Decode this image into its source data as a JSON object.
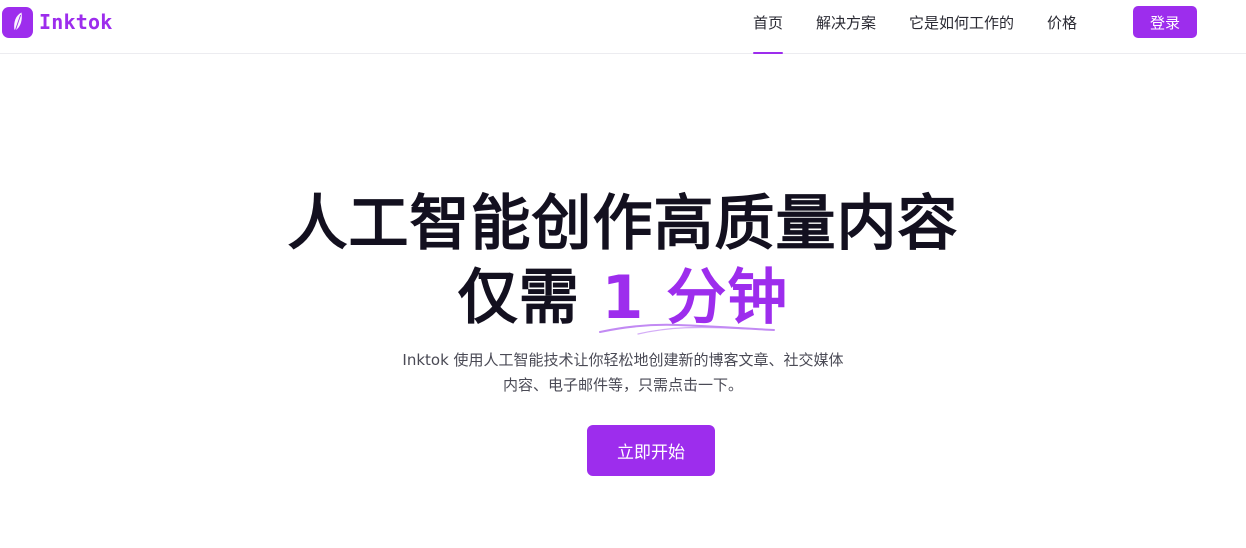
{
  "brand": {
    "name": "Inktok",
    "color": "#9d2ded",
    "logo_icon": "feather-icon"
  },
  "nav": {
    "items": [
      {
        "label": "首页",
        "active": true
      },
      {
        "label": "解决方案",
        "active": false
      },
      {
        "label": "它是如何工作的",
        "active": false
      },
      {
        "label": "价格",
        "active": false
      }
    ],
    "login_label": "登录"
  },
  "hero": {
    "title_line1": "人工智能创作高质量内容",
    "title_line2_prefix": "仅需",
    "title_line2_highlight": "1 分钟",
    "subtitle_line1": "Inktok 使用人工智能技术让你轻松地创建新的博客文章、社交媒体",
    "subtitle_line2": "内容、电子邮件等，只需点击一下。",
    "cta_label": "立即开始"
  }
}
